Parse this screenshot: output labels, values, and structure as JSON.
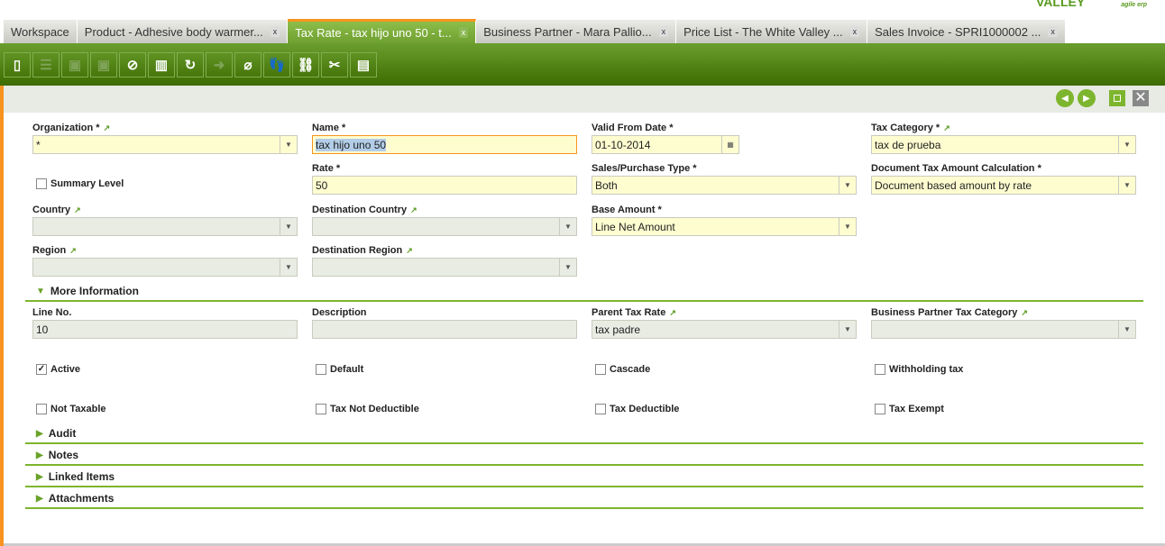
{
  "logo": {
    "brand": "VALLEY",
    "tag": "agile erp"
  },
  "tabs": [
    {
      "label": "Workspace"
    },
    {
      "label": "Product - Adhesive body warmer..."
    },
    {
      "label": "Tax Rate - tax hijo uno 50 - t..."
    },
    {
      "label": "Business Partner - Mara Pallio..."
    },
    {
      "label": "Price List - The White Valley ..."
    },
    {
      "label": "Sales Invoice - SPRI1000002 ..."
    }
  ],
  "close_glyph": "x",
  "toolbar": [
    "new-document",
    "new-row",
    "save",
    "save-close",
    "undo",
    "delete",
    "refresh",
    "export",
    "attach",
    "audit-trail",
    "link",
    "customize",
    "toggle-view"
  ],
  "fields": {
    "organization": {
      "label": "Organization *",
      "value": "*"
    },
    "name": {
      "label": "Name *",
      "value": "tax hijo uno 50"
    },
    "valid_from": {
      "label": "Valid From Date *",
      "value": "01-10-2014"
    },
    "tax_category": {
      "label": "Tax Category *",
      "value": "tax de prueba"
    },
    "summary_level": {
      "label": "Summary Level"
    },
    "rate": {
      "label": "Rate *",
      "value": "50"
    },
    "sales_purchase": {
      "label": "Sales/Purchase Type *",
      "value": "Both"
    },
    "doc_tax_calc": {
      "label": "Document Tax Amount Calculation *",
      "value": "Document based amount by rate"
    },
    "country": {
      "label": "Country",
      "value": ""
    },
    "dest_country": {
      "label": "Destination Country",
      "value": ""
    },
    "base_amount": {
      "label": "Base Amount *",
      "value": "Line Net Amount"
    },
    "region": {
      "label": "Region",
      "value": ""
    },
    "dest_region": {
      "label": "Destination Region",
      "value": ""
    }
  },
  "more": {
    "title": "More Information",
    "line_no": {
      "label": "Line No.",
      "value": "10"
    },
    "description": {
      "label": "Description",
      "value": ""
    },
    "parent_tax": {
      "label": "Parent Tax Rate",
      "value": "tax padre"
    },
    "bp_tax_cat": {
      "label": "Business Partner Tax Category",
      "value": ""
    },
    "checks": [
      {
        "label": "Active",
        "checked": true
      },
      {
        "label": "Default"
      },
      {
        "label": "Cascade"
      },
      {
        "label": "Withholding tax"
      },
      {
        "label": "Not Taxable"
      },
      {
        "label": "Tax Not Deductible"
      },
      {
        "label": "Tax Deductible"
      },
      {
        "label": "Tax Exempt"
      }
    ]
  },
  "sections": [
    "Audit",
    "Notes",
    "Linked Items",
    "Attachments"
  ]
}
